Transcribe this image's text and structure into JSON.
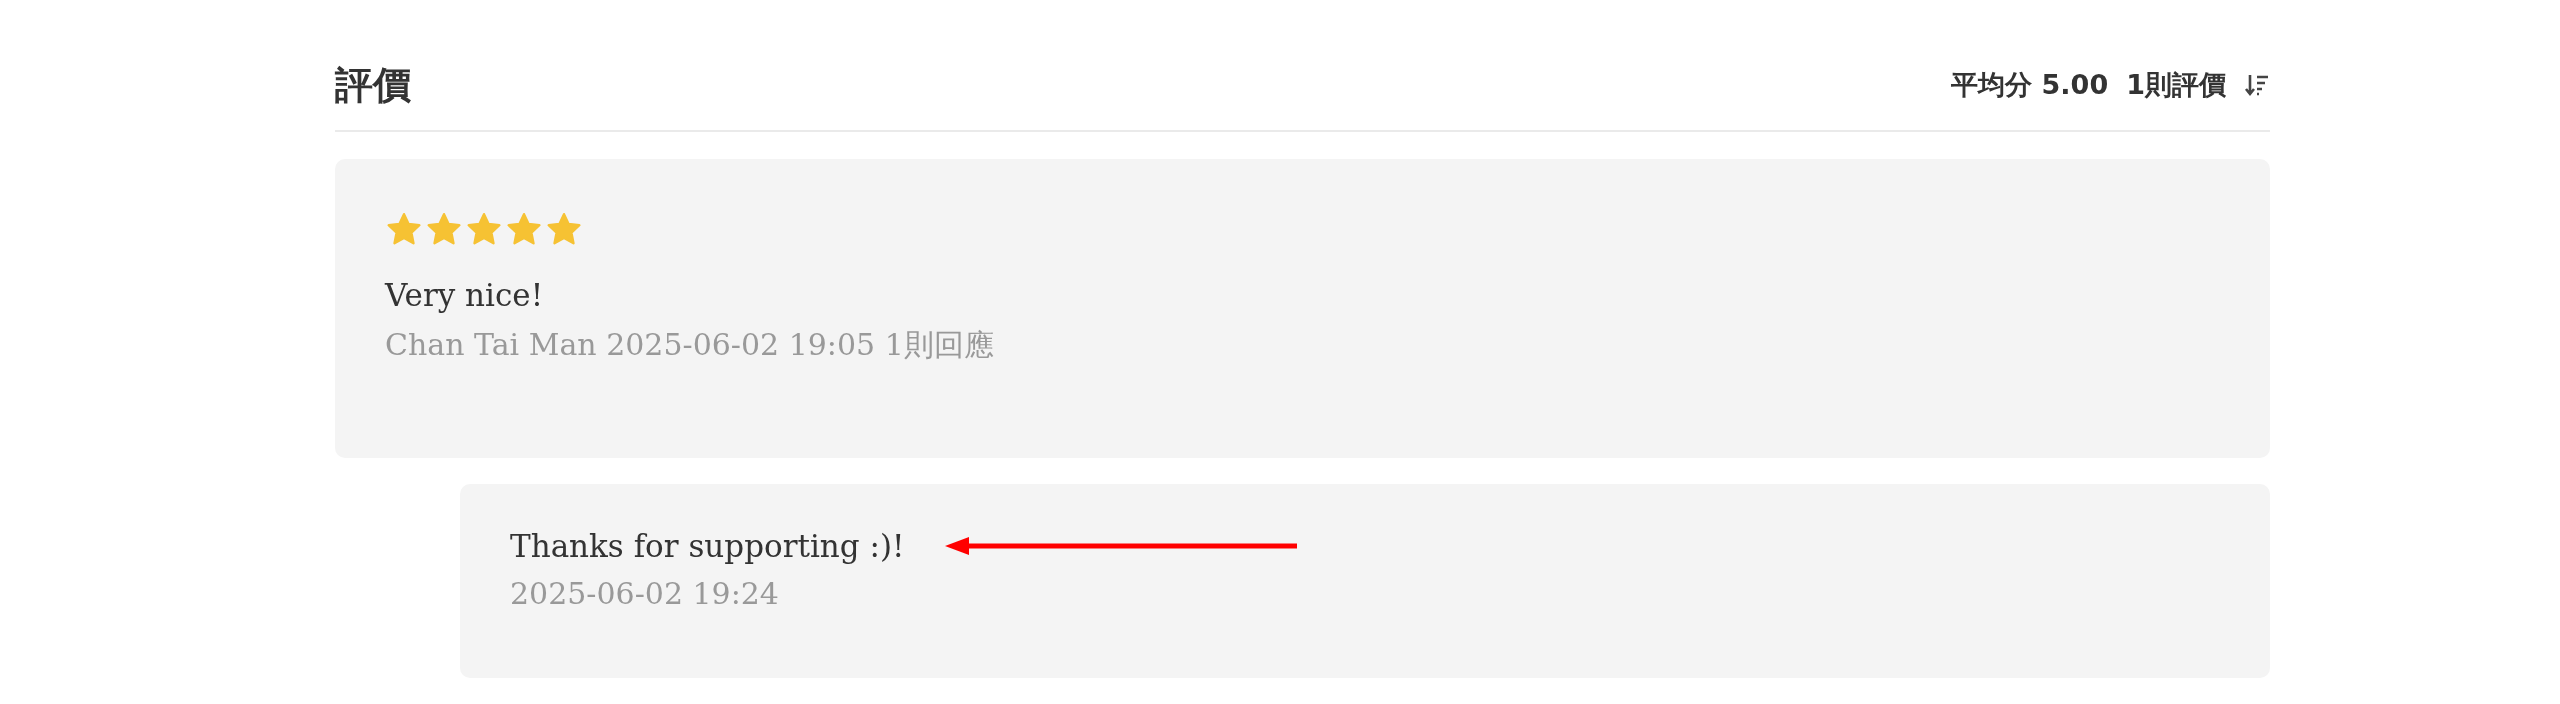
{
  "header": {
    "title": "評價",
    "average": "平均分 5.00",
    "count": "1則評價"
  },
  "review": {
    "stars": 5,
    "text": "Very nice!",
    "meta": "Chan Tai Man 2025-06-02 19:05 1則回應"
  },
  "reply": {
    "text": "Thanks for supporting :)!",
    "date": "2025-06-02 19:24"
  }
}
